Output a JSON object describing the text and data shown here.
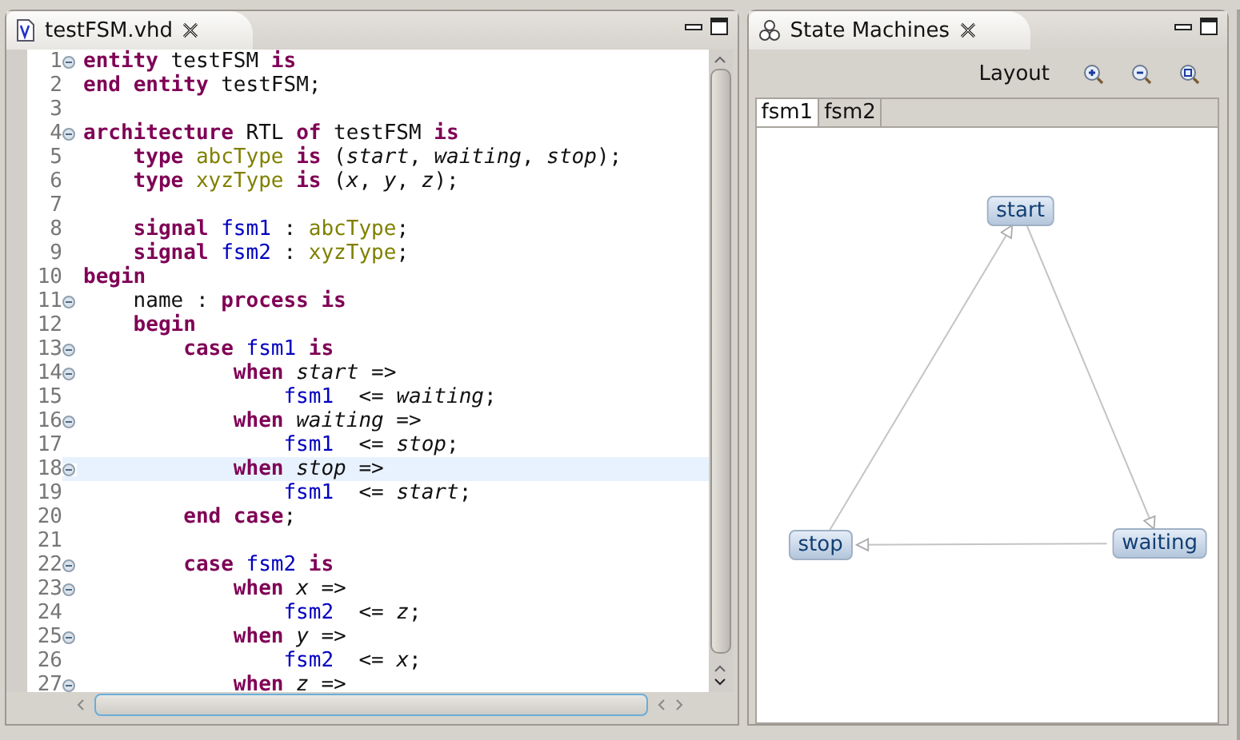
{
  "editor": {
    "title": "testFSM.vhd",
    "lines": [
      {
        "n": "1",
        "fold": true,
        "current": false,
        "tokens": [
          {
            "kind": "kw",
            "text": "entity"
          },
          {
            "kind": "p",
            "text": " testFSM "
          },
          {
            "kind": "kw",
            "text": "is"
          }
        ]
      },
      {
        "n": "2",
        "fold": false,
        "current": false,
        "tokens": [
          {
            "kind": "kw",
            "text": "end "
          },
          {
            "kind": "kw",
            "text": "entity"
          },
          {
            "kind": "p",
            "text": " testFSM;"
          }
        ]
      },
      {
        "n": "3",
        "fold": false,
        "current": false
      },
      {
        "n": "4",
        "fold": true,
        "current": false,
        "tokens": [
          {
            "kind": "kw",
            "text": "architecture"
          },
          {
            "kind": "p",
            "text": " RTL "
          },
          {
            "kind": "kw",
            "text": "of"
          },
          {
            "kind": "p",
            "text": " testFSM "
          },
          {
            "kind": "kw",
            "text": "is"
          }
        ]
      },
      {
        "n": "5",
        "fold": false,
        "current": false,
        "tokens": [
          {
            "kind": "kw",
            "text": "    type "
          },
          {
            "kind": "ty",
            "text": "abcType "
          },
          {
            "kind": "kw",
            "text": "is"
          },
          {
            "kind": "p",
            "text": " ("
          },
          {
            "kind": "it",
            "text": "start"
          },
          {
            "kind": "p",
            "text": ", "
          },
          {
            "kind": "it",
            "text": "waiting"
          },
          {
            "kind": "p",
            "text": ", "
          },
          {
            "kind": "it",
            "text": "stop"
          },
          {
            "kind": "p",
            "text": ");"
          }
        ]
      },
      {
        "n": "6",
        "fold": false,
        "current": false,
        "tokens": [
          {
            "kind": "kw",
            "text": "    type "
          },
          {
            "kind": "ty",
            "text": "xyzType "
          },
          {
            "kind": "kw",
            "text": "is"
          },
          {
            "kind": "p",
            "text": " ("
          },
          {
            "kind": "it",
            "text": "x"
          },
          {
            "kind": "p",
            "text": ", "
          },
          {
            "kind": "it",
            "text": "y"
          },
          {
            "kind": "p",
            "text": ", "
          },
          {
            "kind": "it",
            "text": "z"
          },
          {
            "kind": "p",
            "text": ");"
          }
        ]
      },
      {
        "n": "7",
        "fold": false,
        "current": false
      },
      {
        "n": "8",
        "fold": false,
        "current": false,
        "tokens": [
          {
            "kind": "kw",
            "text": "    signal "
          },
          {
            "kind": "sig",
            "text": "fsm1"
          },
          {
            "kind": "p",
            "text": " : "
          },
          {
            "kind": "ty",
            "text": "abcType"
          },
          {
            "kind": "p",
            "text": ";"
          }
        ]
      },
      {
        "n": "9",
        "fold": false,
        "current": false,
        "tokens": [
          {
            "kind": "kw",
            "text": "    signal "
          },
          {
            "kind": "sig",
            "text": "fsm2"
          },
          {
            "kind": "p",
            "text": " : "
          },
          {
            "kind": "ty",
            "text": "xyzType"
          },
          {
            "kind": "p",
            "text": ";"
          }
        ]
      },
      {
        "n": "10",
        "fold": false,
        "current": false,
        "tokens": [
          {
            "kind": "kw",
            "text": "begin"
          }
        ]
      },
      {
        "n": "11",
        "fold": true,
        "current": false,
        "tokens": [
          {
            "kind": "p",
            "text": "    name : "
          },
          {
            "kind": "kw",
            "text": "process is"
          }
        ]
      },
      {
        "n": "12",
        "fold": false,
        "current": false,
        "tokens": [
          {
            "kind": "kw",
            "text": "    begin"
          }
        ]
      },
      {
        "n": "13",
        "fold": true,
        "current": false,
        "tokens": [
          {
            "kind": "kw",
            "text": "        case "
          },
          {
            "kind": "sig",
            "text": "fsm1 "
          },
          {
            "kind": "kw",
            "text": "is"
          }
        ]
      },
      {
        "n": "14",
        "fold": true,
        "current": false,
        "tokens": [
          {
            "kind": "kw",
            "text": "            when "
          },
          {
            "kind": "it",
            "text": "start"
          },
          {
            "kind": "p",
            "text": " =>"
          }
        ]
      },
      {
        "n": "15",
        "fold": false,
        "current": false,
        "tokens": [
          {
            "kind": "sig",
            "text": "                fsm1"
          },
          {
            "kind": "p",
            "text": "  <= "
          },
          {
            "kind": "it",
            "text": "waiting"
          },
          {
            "kind": "p",
            "text": ";"
          }
        ]
      },
      {
        "n": "16",
        "fold": true,
        "current": false,
        "tokens": [
          {
            "kind": "kw",
            "text": "            when "
          },
          {
            "kind": "it",
            "text": "waiting"
          },
          {
            "kind": "p",
            "text": " =>"
          }
        ]
      },
      {
        "n": "17",
        "fold": false,
        "current": false,
        "tokens": [
          {
            "kind": "sig",
            "text": "                fsm1"
          },
          {
            "kind": "p",
            "text": "  <= "
          },
          {
            "kind": "it",
            "text": "stop"
          },
          {
            "kind": "p",
            "text": ";"
          }
        ]
      },
      {
        "n": "18",
        "fold": true,
        "current": true,
        "tokens": [
          {
            "kind": "kw",
            "text": "            when "
          },
          {
            "kind": "it",
            "text": "stop"
          },
          {
            "kind": "p",
            "text": " =>"
          }
        ]
      },
      {
        "n": "19",
        "fold": false,
        "current": false,
        "tokens": [
          {
            "kind": "sig",
            "text": "                fsm1"
          },
          {
            "kind": "p",
            "text": "  <= "
          },
          {
            "kind": "it",
            "text": "start"
          },
          {
            "kind": "p",
            "text": ";"
          }
        ]
      },
      {
        "n": "20",
        "fold": false,
        "current": false,
        "tokens": [
          {
            "kind": "kw",
            "text": "        end case"
          },
          {
            "kind": "p",
            "text": ";"
          }
        ]
      },
      {
        "n": "21",
        "fold": false,
        "current": false
      },
      {
        "n": "22",
        "fold": true,
        "current": false,
        "tokens": [
          {
            "kind": "kw",
            "text": "        case "
          },
          {
            "kind": "sig",
            "text": "fsm2 "
          },
          {
            "kind": "kw",
            "text": "is"
          }
        ]
      },
      {
        "n": "23",
        "fold": true,
        "current": false,
        "tokens": [
          {
            "kind": "kw",
            "text": "            when "
          },
          {
            "kind": "it",
            "text": "x"
          },
          {
            "kind": "p",
            "text": " =>"
          }
        ]
      },
      {
        "n": "24",
        "fold": false,
        "current": false,
        "tokens": [
          {
            "kind": "sig",
            "text": "                fsm2"
          },
          {
            "kind": "p",
            "text": "  <= "
          },
          {
            "kind": "it",
            "text": "z"
          },
          {
            "kind": "p",
            "text": ";"
          }
        ]
      },
      {
        "n": "25",
        "fold": true,
        "current": false,
        "tokens": [
          {
            "kind": "kw",
            "text": "            when "
          },
          {
            "kind": "it",
            "text": "y"
          },
          {
            "kind": "p",
            "text": " =>"
          }
        ]
      },
      {
        "n": "26",
        "fold": false,
        "current": false,
        "tokens": [
          {
            "kind": "sig",
            "text": "                fsm2"
          },
          {
            "kind": "p",
            "text": "  <= "
          },
          {
            "kind": "it",
            "text": "x"
          },
          {
            "kind": "p",
            "text": ";"
          }
        ]
      },
      {
        "n": "27",
        "fold": true,
        "current": false,
        "tokens": [
          {
            "kind": "kw",
            "text": "            when "
          },
          {
            "kind": "it",
            "text": "z"
          },
          {
            "kind": "p",
            "text": " =>"
          }
        ]
      }
    ]
  },
  "state_machines": {
    "title": "State Machines",
    "layout": "Layout",
    "tabs": [
      {
        "label": "fsm1",
        "selected": true
      },
      {
        "label": "fsm2",
        "selected": false
      }
    ],
    "states": [
      {
        "name": "start"
      },
      {
        "name": "waiting"
      },
      {
        "name": "stop"
      }
    ]
  }
}
